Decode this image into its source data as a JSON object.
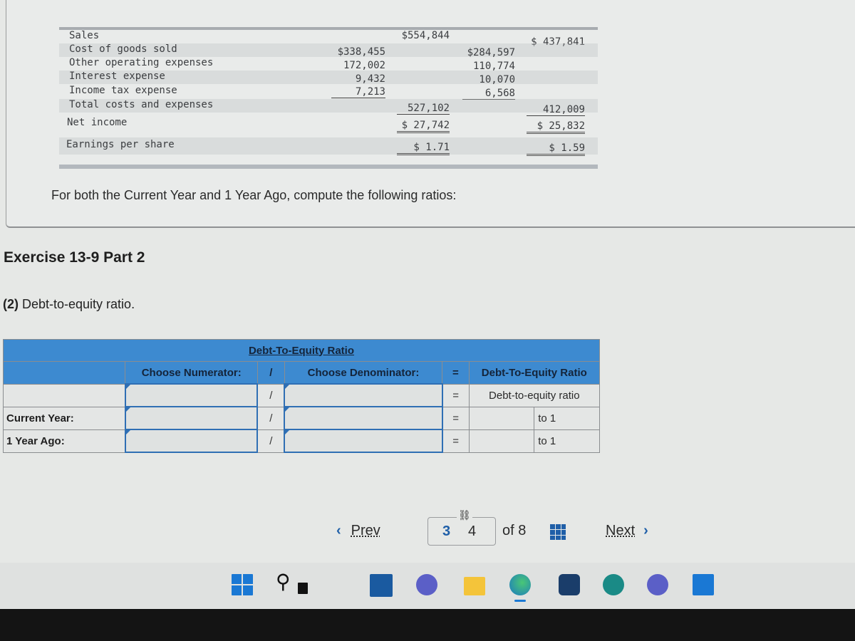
{
  "income_statement": {
    "rows": [
      {
        "label": "Sales",
        "col1": "",
        "col2": "$554,844",
        "col3": "",
        "col4": "$ 437,841"
      },
      {
        "label": "Cost of goods sold",
        "col1": "$338,455",
        "col2": "",
        "col3": "$284,597",
        "col4": ""
      },
      {
        "label": "Other operating expenses",
        "col1": "172,002",
        "col2": "",
        "col3": "110,774",
        "col4": ""
      },
      {
        "label": "Interest expense",
        "col1": "9,432",
        "col2": "",
        "col3": "10,070",
        "col4": ""
      },
      {
        "label": "Income tax expense",
        "col1": "7,213",
        "col2": "",
        "col3": "6,568",
        "col4": ""
      },
      {
        "label": "Total costs and expenses",
        "col1": "",
        "col2": "527,102",
        "col3": "",
        "col4": "412,009"
      },
      {
        "label": "Net income",
        "col1": "",
        "col2": "$ 27,742",
        "col3": "",
        "col4": "$  25,832"
      },
      {
        "label": "Earnings per share",
        "col1": "",
        "col2": "$    1.71",
        "col3": "",
        "col4": "$     1.59"
      }
    ]
  },
  "instruction": "For both the Current Year and 1 Year Ago, compute the following ratios:",
  "part": {
    "title": "Exercise 13-9 Part 2",
    "question_num": "(2)",
    "question_text": " Debt-to-equity ratio."
  },
  "ratio_table": {
    "title": "Debt-To-Equity Ratio",
    "numerator_header": "Choose Numerator:",
    "divide_symbol": "/",
    "denominator_header": "Choose Denominator:",
    "equals_symbol": "=",
    "result_header": "Debt-To-Equity Ratio",
    "result_subheader": "Debt-to-equity ratio",
    "rows": [
      {
        "label": "",
        "numerator": "",
        "denominator": ""
      },
      {
        "label": "Current Year:",
        "numerator": "",
        "denominator": "",
        "result": "",
        "suffix": "to 1"
      },
      {
        "label": "1 Year Ago:",
        "numerator": "",
        "denominator": "",
        "result": "",
        "suffix": "to 1"
      }
    ]
  },
  "pagination": {
    "prev_label": "Prev",
    "prev_icon": "‹",
    "current_page": "3",
    "next_page": "4",
    "of_total": "of 8",
    "next_label": "Next",
    "next_icon": "›",
    "link_icon": "⛓"
  },
  "taskbar": {
    "icons": [
      "windows-start",
      "search",
      "task-view",
      "widgets",
      "teams-chat",
      "file-explorer",
      "edge",
      "microsoft-store",
      "feedback-hub",
      "quick-assist",
      "cortana"
    ]
  }
}
